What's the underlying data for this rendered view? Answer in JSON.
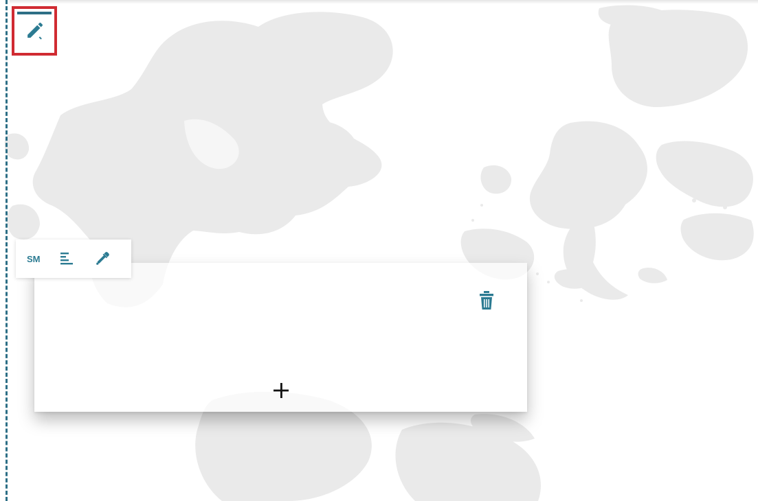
{
  "editor": {
    "size_label": "SM",
    "accent_color": "#2c7b92",
    "highlight_color": "#d02b32",
    "guide_color": "#2d6f86"
  },
  "icons": {
    "edit_tool": "pencil-icon",
    "text_align": "align-left-icon",
    "color_picker": "eyedropper-icon",
    "delete": "trash-icon",
    "add": "plus-icon"
  }
}
